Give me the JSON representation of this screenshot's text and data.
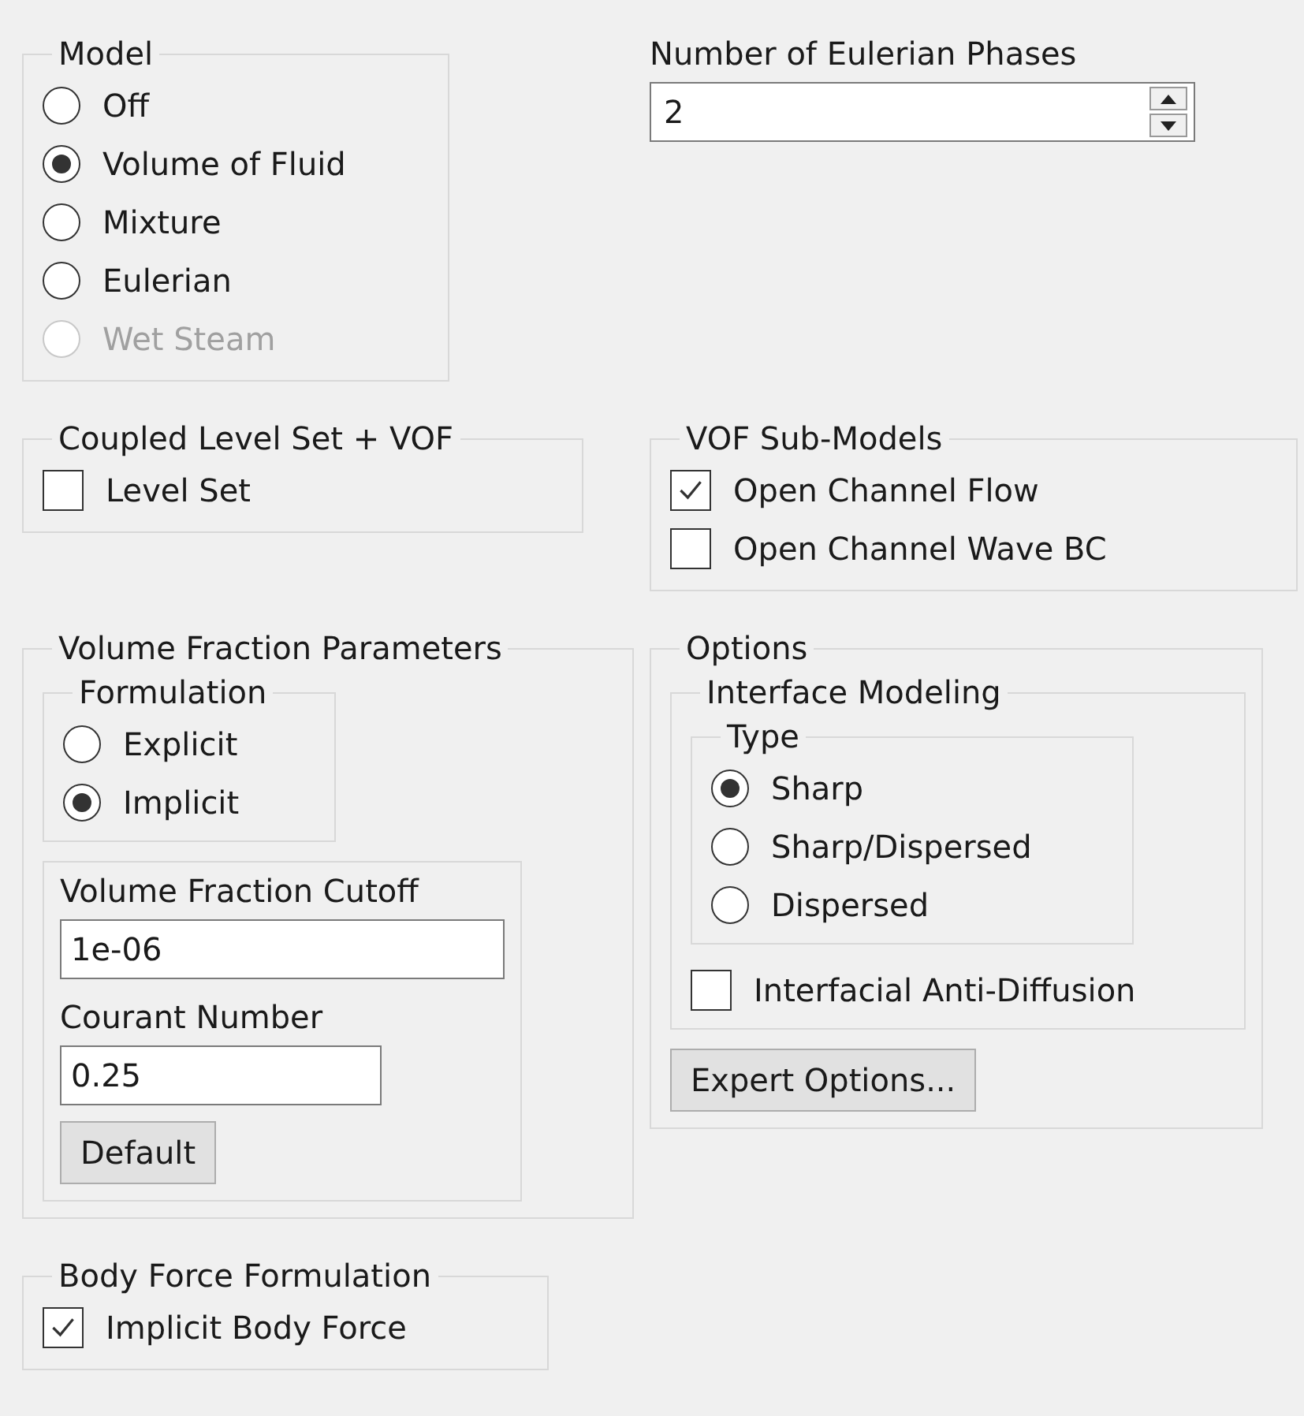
{
  "model": {
    "label": "Model",
    "options": [
      {
        "label": "Off",
        "selected": false,
        "disabled": false
      },
      {
        "label": "Volume of Fluid",
        "selected": true,
        "disabled": false
      },
      {
        "label": "Mixture",
        "selected": false,
        "disabled": false
      },
      {
        "label": "Eulerian",
        "selected": false,
        "disabled": false
      },
      {
        "label": "Wet Steam",
        "selected": false,
        "disabled": true
      }
    ]
  },
  "phases": {
    "label": "Number of Eulerian Phases",
    "value": "2"
  },
  "coupled": {
    "label": "Coupled Level Set + VOF",
    "checkboxes": [
      {
        "label": "Level Set",
        "checked": false
      }
    ]
  },
  "vof_submodels": {
    "label": "VOF Sub-Models",
    "checkboxes": [
      {
        "label": "Open Channel Flow",
        "checked": true
      },
      {
        "label": "Open Channel Wave BC",
        "checked": false
      }
    ]
  },
  "vf_params": {
    "label": "Volume Fraction Parameters",
    "formulation": {
      "label": "Formulation",
      "options": [
        {
          "label": "Explicit",
          "selected": false,
          "disabled": false
        },
        {
          "label": "Implicit",
          "selected": true,
          "disabled": false
        }
      ]
    },
    "fields": [
      {
        "label": "Volume Fraction Cutoff",
        "value": "1e-06"
      },
      {
        "label": "Courant Number",
        "value": "0.25"
      }
    ],
    "default_button": "Default"
  },
  "options": {
    "label": "Options",
    "interface": {
      "label": "Interface Modeling",
      "type": {
        "label": "Type",
        "options": [
          {
            "label": "Sharp",
            "selected": true,
            "disabled": false
          },
          {
            "label": "Sharp/Dispersed",
            "selected": false,
            "disabled": false
          },
          {
            "label": "Dispersed",
            "selected": false,
            "disabled": false
          }
        ]
      },
      "checkboxes": [
        {
          "label": "Interfacial Anti-Diffusion",
          "checked": false
        }
      ]
    },
    "expert_button": "Expert Options..."
  },
  "body_force": {
    "label": "Body Force Formulation",
    "checkboxes": [
      {
        "label": "Implicit Body Force",
        "checked": true
      }
    ]
  }
}
